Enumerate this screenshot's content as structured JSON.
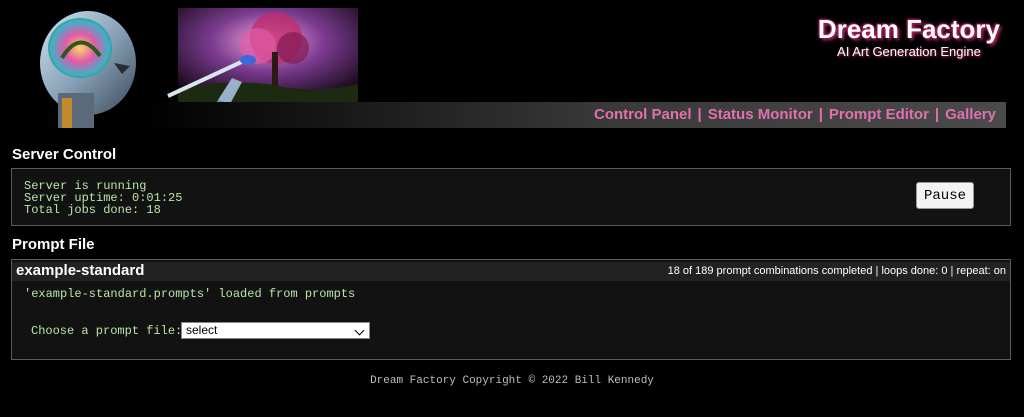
{
  "brand": {
    "title": "Dream Factory",
    "subtitle": "AI Art Generation Engine"
  },
  "nav": {
    "items": [
      "Control Panel",
      "Status Monitor",
      "Prompt Editor",
      "Gallery"
    ],
    "separator": "|"
  },
  "server_control": {
    "heading": "Server Control",
    "status_lines": [
      "Server is running",
      "Server uptime: 0:01:25",
      "Total jobs done: 18"
    ],
    "pause_label": "Pause"
  },
  "prompt_file": {
    "heading": "Prompt File",
    "name": "example-standard",
    "progress_text": "18 of 189 prompt combinations completed | loops done: 0 | repeat: on",
    "loaded_message": "'example-standard.prompts' loaded from prompts",
    "choose_label": "Choose a prompt file:",
    "select_value": "select"
  },
  "footer": "Dream Factory Copyright © 2022 Bill Kennedy",
  "colors": {
    "background": "#000000",
    "nav_link": "#e070b0",
    "mono_text": "#b8e6a6",
    "panel_border": "#5a5a5a"
  }
}
